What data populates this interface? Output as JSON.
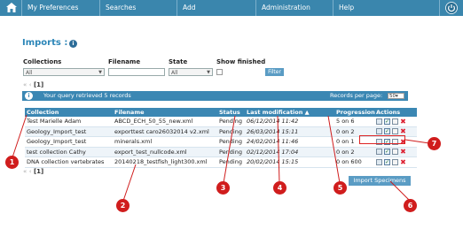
{
  "nav": {
    "items": [
      "My Preferences",
      "Searches",
      "Add",
      "Administration",
      "Help"
    ]
  },
  "page": {
    "title": "Imports :",
    "info_icon": "i"
  },
  "filters": {
    "collections_label": "Collections",
    "collections_value": "All",
    "filename_label": "Filename",
    "filename_value": "",
    "state_label": "State",
    "state_value": "All",
    "show_finished_label": "Show finished",
    "filter_button": "Filter"
  },
  "pager": {
    "first": "«",
    "prev": "‹",
    "current": "[1]"
  },
  "info_bar": {
    "message": "Your query retrieved 5 records",
    "records_label": "Records per page:",
    "records_value": "50"
  },
  "table": {
    "headers": [
      "Collection",
      "Filename",
      "Status",
      "Last modification ▲",
      "Progression",
      "Actions"
    ],
    "rows": [
      {
        "collection": "Test Marielle Adam",
        "filename": "ABCD_ECH_50_55_new.xml",
        "status": "Pending",
        "date": "06/12/2014 11:42",
        "progression": "5 on 6"
      },
      {
        "collection": "Geology_Import_test",
        "filename": "exporttest caro26032014 v2.xml",
        "status": "Pending",
        "date": "26/03/2014 15:11",
        "progression": "0 on 2"
      },
      {
        "collection": "Geology_Import_test",
        "filename": "minerals.xml",
        "status": "Pending",
        "date": "24/02/2014 11:46",
        "progression": "0 on 1"
      },
      {
        "collection": "test collection Cathy",
        "filename": "export_test_nullcode.xml",
        "status": "Pending",
        "date": "02/12/2014 17:04",
        "progression": "0 on 2"
      },
      {
        "collection": "DNA collection vertebrates",
        "filename": "20140218_testfish_light300.xml",
        "status": "Pending",
        "date": "20/02/2014 15:15",
        "progression": "0 on 600"
      }
    ]
  },
  "import_button": "Import Specimens",
  "callouts": [
    "1",
    "2",
    "3",
    "4",
    "5",
    "6",
    "7"
  ],
  "icons": [
    "home-icon",
    "power-icon",
    "edit-icon",
    "validate-icon",
    "report-icon",
    "delete-icon"
  ],
  "colors": {
    "nav": "#3a86ad",
    "accent": "#2c86b8",
    "callout": "#d01d1d"
  }
}
